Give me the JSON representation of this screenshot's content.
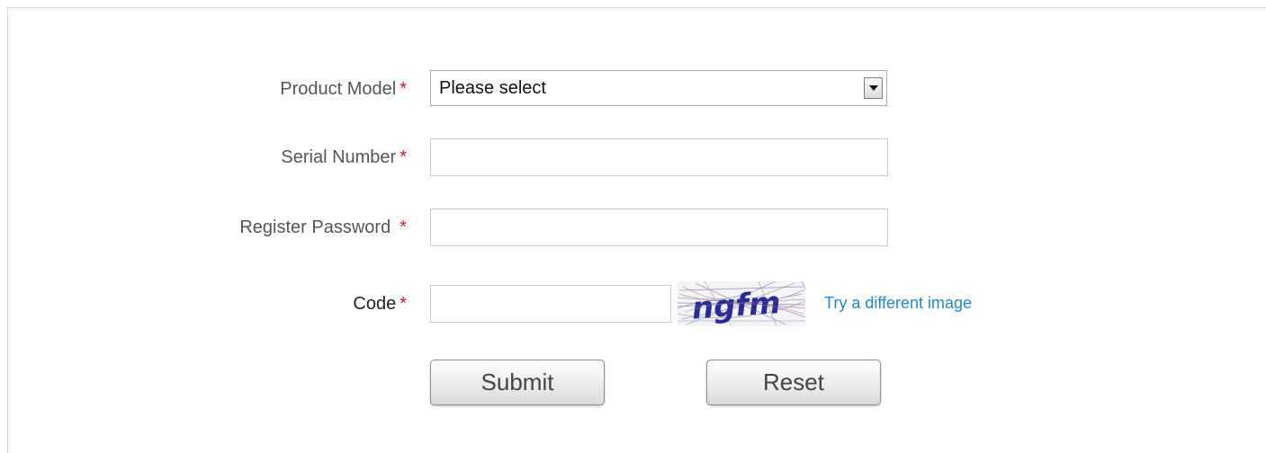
{
  "form": {
    "required_marker": "*",
    "product_model": {
      "label": "Product Model",
      "selected_value": "Please select"
    },
    "serial_number": {
      "label": "Serial Number",
      "value": ""
    },
    "register_password": {
      "label": "Register Password",
      "value": ""
    },
    "code": {
      "label": "Code",
      "value": "",
      "captcha_text": "ngfm",
      "refresh_link": "Try a different image"
    },
    "buttons": {
      "submit": "Submit",
      "reset": "Reset"
    }
  },
  "colors": {
    "required": "#d0181f",
    "link": "#1d8ac9",
    "captcha_ink": "#2a2a9a"
  }
}
